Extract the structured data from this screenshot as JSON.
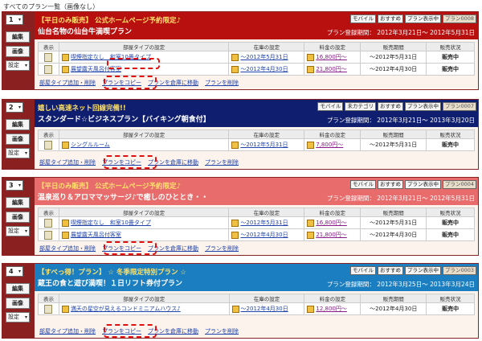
{
  "page": {
    "title": "すべてのプラン一覧（画像なし）"
  },
  "side": {
    "edit": "編集",
    "image": "画像",
    "settings": "設定",
    "arrow": "▾"
  },
  "table_headers": [
    "表示",
    "部屋タイプの設定",
    "在庫の設定",
    "料金の設定",
    "販売期間",
    "販売状況"
  ],
  "actions": {
    "add_room": "部屋タイプ追加・削除",
    "copy": "プランをコピー",
    "move": "プランを倉庫に移動",
    "delete": "プランを削除"
  },
  "colors": {
    "dark_red": "#b80f0f",
    "navy": "#0f1e6e",
    "pink": "#e86c6c",
    "sky": "#1a7ec0"
  },
  "plans": [
    {
      "num": "1",
      "line1": "【平日のみ販売】 公式ホームページ予約限定♪",
      "line2": "仙台名物の仙台牛満喫プラン",
      "period": "プラン登録期間： 2012年3月21日～ 2012年5月31日",
      "tags": [
        "モバイル",
        "おすすめ",
        "プラン表示中",
        "プラン0008"
      ],
      "rows": [
        {
          "room": "喫煙指定なし　和室10畳タイプ",
          "stock": "～2012年5月31日",
          "price": "16,800円～",
          "sales": "～2012年5月31日",
          "status": "販売中"
        },
        {
          "room": "展望露天風呂付客室",
          "stock": "～2012年4月30日",
          "price": "21,800円～",
          "sales": "～2012年4月30日",
          "status": "販売中"
        }
      ]
    },
    {
      "num": "2",
      "line1": "嬉しい高速ネット回線完備!!",
      "line2": "スタンダード☆ビジネスプラン【バイキング朝食付】",
      "period": "プラン登録期間： 2012年3月21日～ 2013年3月20日",
      "tags": [
        "モバイル",
        "未カテゴリ",
        "おすすめ",
        "プラン表示中",
        "プラン0007"
      ],
      "rows": [
        {
          "room": "シングルルーム",
          "stock": "～2012年5月31日",
          "price": "7,800円～",
          "sales": "～2012年5月31日",
          "status": "販売中"
        }
      ]
    },
    {
      "num": "3",
      "line1": "【平日のみ販売】 公式ホームページ予約限定♪",
      "line2": "温泉巡り＆アロママッサージ♪で癒しのひととき・・",
      "period": "プラン登録期間： 2012年3月21日～ 2012年5月31日",
      "tags": [
        "モバイル",
        "おすすめ",
        "プラン表示中",
        "プラン0004"
      ],
      "rows": [
        {
          "room": "喫煙指定なし　和室10畳タイプ",
          "stock": "～2012年5月31日",
          "price": "16,800円～",
          "sales": "～2012年5月31日",
          "status": "販売中"
        },
        {
          "room": "展望露天風呂付客室",
          "stock": "～2012年4月30日",
          "price": "21,800円～",
          "sales": "～2012年4月30日",
          "status": "販売中"
        }
      ]
    },
    {
      "num": "4",
      "line1": "【すべっ得！プラン】 ☆ 冬季限定特別プラン ☆",
      "line2": "蔵王の食と遊び満喫！１日リフト券付プラン",
      "period": "プラン登録期間： 2012年3月25日～ 2013年3月24日",
      "tags": [
        "モバイル",
        "おすすめ",
        "プラン表示中",
        "プラン0003"
      ],
      "rows": [
        {
          "room": "満天の星空が見えるコンドミニアムハウス♪",
          "stock": "～2012年4月30日",
          "price": "12,800円～",
          "sales": "～2012年4月30日",
          "status": "販売中"
        }
      ]
    }
  ]
}
